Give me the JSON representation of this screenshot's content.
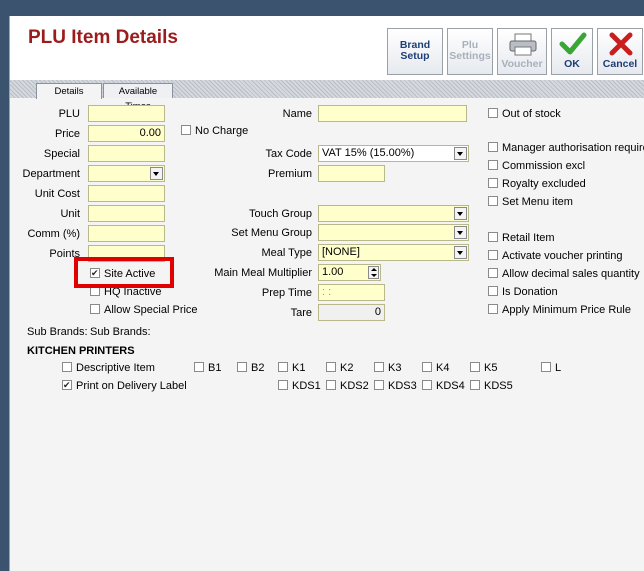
{
  "header": {
    "title": "PLU Item Details",
    "buttons": {
      "brand_setup": "Brand Setup",
      "brand_setup_l1": "Brand",
      "brand_setup_l2": "Setup",
      "plu_settings_l1": "Plu",
      "plu_settings_l2": "Settings",
      "voucher": "Voucher",
      "ok": "OK",
      "cancel": "Cancel"
    },
    "colors": {
      "title": "#9b1c1c",
      "ok_icon": "#3aa635",
      "cancel_icon": "#c81e1e"
    }
  },
  "tabs": {
    "details": "Details",
    "available_times": "Available Times"
  },
  "left": {
    "plu": "PLU",
    "price": "Price",
    "price_value": "0.00",
    "no_charge": "No Charge",
    "special": "Special",
    "department": "Department",
    "unit_cost": "Unit Cost",
    "unit": "Unit",
    "comm": "Comm (%)",
    "points": "Points",
    "site_active": "Site Active",
    "hq_inactive": "HQ Inactive",
    "allow_special_price": "Allow Special Price"
  },
  "middle": {
    "name": "Name",
    "tax_code": "Tax Code",
    "tax_code_value": "VAT 15% (15.00%)",
    "premium": "Premium",
    "touch_group": "Touch Group",
    "set_menu_group": "Set Menu Group",
    "meal_type": "Meal Type",
    "meal_type_value": "[NONE]",
    "main_meal_multiplier": "Main Meal Multiplier",
    "main_meal_multiplier_value": "1.00",
    "prep_time": "Prep Time",
    "prep_time_value": ": :",
    "tare": "Tare",
    "tare_value": "0"
  },
  "right": {
    "out_of_stock": "Out of stock",
    "manager_auth": "Manager authorisation required",
    "commission_excl": "Commission excl",
    "royalty_excluded": "Royalty excluded",
    "set_menu_item": "Set Menu item",
    "retail_item": "Retail Item",
    "activate_voucher": "Activate voucher printing",
    "allow_decimal": "Allow decimal sales quantity",
    "is_donation": "Is Donation",
    "apply_min_price": "Apply Minimum Price Rule"
  },
  "sub_brands": {
    "label1": "Sub Brands:",
    "label2": "Sub Brands:"
  },
  "kitchen": {
    "heading": "KITCHEN PRINTERS",
    "descriptive_item": "Descriptive Item",
    "print_on_delivery": "Print on Delivery Label",
    "printers_row1": [
      "B1",
      "B2",
      "K1",
      "K2",
      "K3",
      "K4",
      "K5",
      "L"
    ],
    "printers_row2": [
      "KDS1",
      "KDS2",
      "KDS3",
      "KDS4",
      "KDS5"
    ]
  },
  "checked": {
    "site_active": true,
    "print_on_delivery": true
  }
}
